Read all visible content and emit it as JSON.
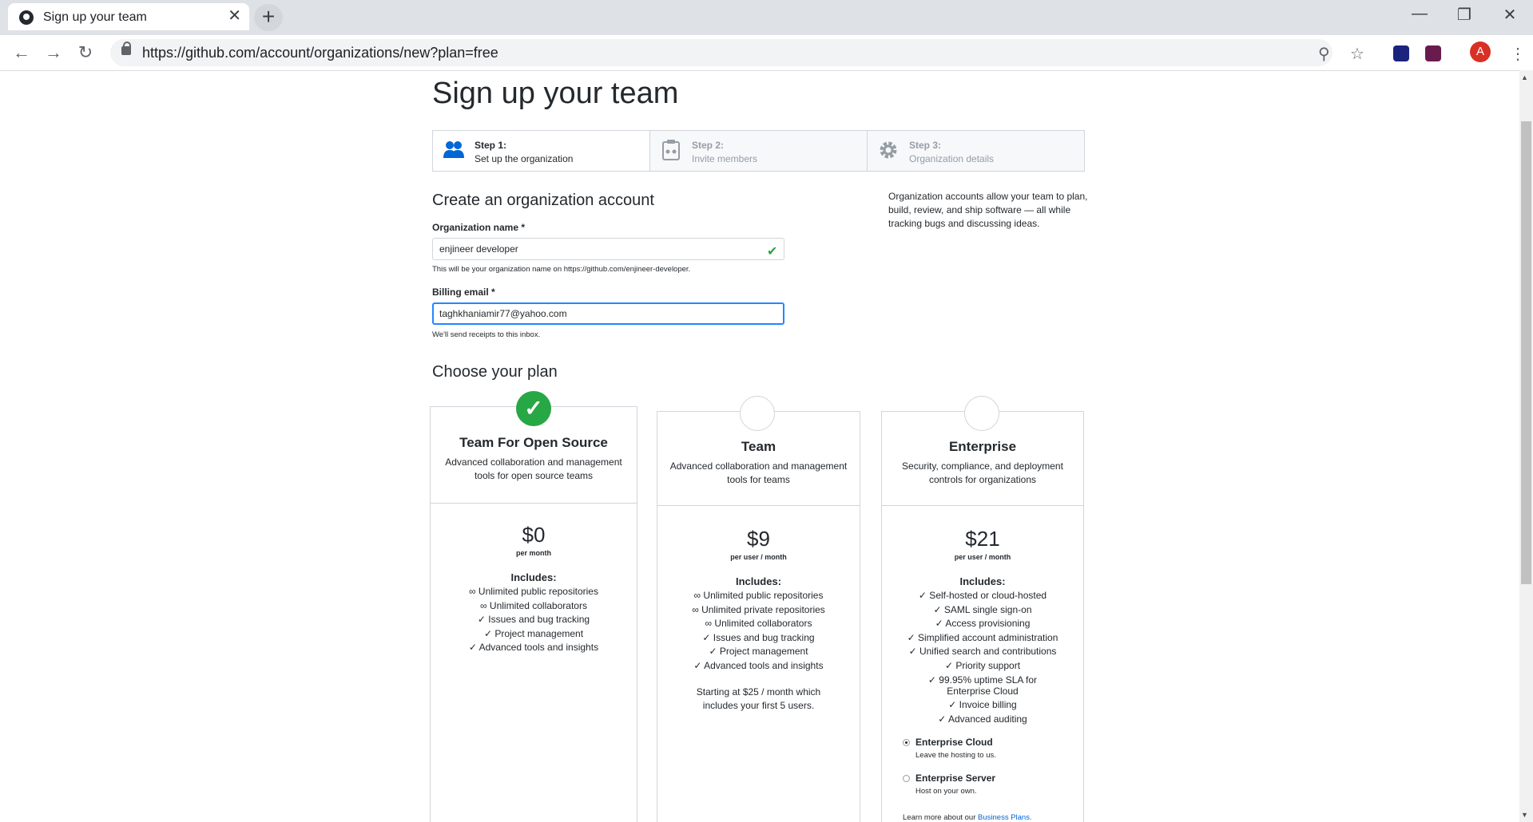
{
  "browser": {
    "tab_title": "Sign up your team",
    "tab_close": "✕",
    "new_tab": "+",
    "url": "https://github.com/account/organizations/new?plan=free",
    "avatar_letter": "A",
    "minimize": "—",
    "restore": "❐",
    "close": "✕",
    "back": "←",
    "forward": "→",
    "reload": "↻",
    "zoom_icon": "⚲",
    "star_icon": "☆",
    "menu_icon": "⋮"
  },
  "page": {
    "title": "Sign up your team"
  },
  "steps": [
    {
      "label": "Step 1:",
      "desc": "Set up the organization",
      "icon": "people-icon",
      "active": true
    },
    {
      "label": "Step 2:",
      "desc": "Invite members",
      "icon": "clipboard-icon",
      "active": false
    },
    {
      "label": "Step 3:",
      "desc": "Organization details",
      "icon": "gear-icon",
      "active": false
    }
  ],
  "form": {
    "heading": "Create an organization account",
    "org_name_label": "Organization name *",
    "org_name_value": "enjineer developer",
    "org_name_note": "This will be your organization name on https://github.com/enjineer-developer.",
    "billing_label": "Billing email *",
    "billing_value": "taghkhaniamir77@yahoo.com",
    "billing_note": "We'll send receipts to this inbox.",
    "valid_check": "✔"
  },
  "sidebar": {
    "note": "Organization accounts allow your team to plan, build, review, and ship software — all while tracking bugs and discussing ideas."
  },
  "plans": {
    "heading": "Choose your plan",
    "includes_label": "Includes:",
    "cards": [
      {
        "name": "Team For Open Source",
        "desc": "Advanced collaboration and management tools for open source teams",
        "price": "$0",
        "per": "per month",
        "selected": true,
        "features": [
          "∞ Unlimited public repositories",
          "∞ Unlimited collaborators",
          "✓ Issues and bug tracking",
          "✓ Project management",
          "✓ Advanced tools and insights"
        ]
      },
      {
        "name": "Team",
        "desc": "Advanced collaboration and management tools for teams",
        "price": "$9",
        "per": "per user / month",
        "selected": false,
        "features": [
          "∞ Unlimited public repositories",
          "∞ Unlimited private repositories",
          "∞ Unlimited collaborators",
          "✓ Issues and bug tracking",
          "✓ Project management",
          "✓ Advanced tools and insights"
        ],
        "starting": "Starting at $25 / month which includes your first 5 users."
      },
      {
        "name": "Enterprise",
        "desc": "Security, compliance, and deployment controls for organizations",
        "price": "$21",
        "per": "per user / month",
        "selected": false,
        "features": [
          "✓ Self-hosted or cloud-hosted",
          "✓ SAML single sign-on",
          "✓ Access provisioning",
          "✓ Simplified account administration",
          "✓ Unified search and contributions",
          "✓ Priority support",
          "✓ 99.95% uptime SLA for Enterprise Cloud",
          "✓ Invoice billing",
          "✓ Advanced auditing"
        ],
        "options": [
          {
            "label": "Enterprise Cloud",
            "sub": "Leave the hosting to us.",
            "checked": true
          },
          {
            "label": "Enterprise Server",
            "sub": "Host on your own.",
            "checked": false
          }
        ],
        "learn_text": "Learn more about our ",
        "learn_link": "Business Plans."
      }
    ]
  }
}
